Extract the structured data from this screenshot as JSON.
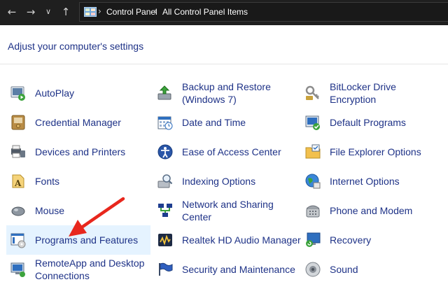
{
  "address_bar": {
    "crumbs": [
      "Control Panel",
      "All Control Panel Items"
    ]
  },
  "heading": "Adjust your computer's settings",
  "items": [
    {
      "label": "AutoPlay",
      "icon": "autoplay-icon"
    },
    {
      "label": "Backup and Restore (Windows 7)",
      "icon": "backup-restore-icon"
    },
    {
      "label": "BitLocker Drive Encryption",
      "icon": "bitlocker-icon"
    },
    {
      "label": "Credential Manager",
      "icon": "credential-manager-icon"
    },
    {
      "label": "Date and Time",
      "icon": "date-time-icon"
    },
    {
      "label": "Default Programs",
      "icon": "default-programs-icon"
    },
    {
      "label": "Devices and Printers",
      "icon": "devices-printers-icon"
    },
    {
      "label": "Ease of Access Center",
      "icon": "ease-of-access-icon"
    },
    {
      "label": "File Explorer Options",
      "icon": "file-explorer-options-icon"
    },
    {
      "label": "Fonts",
      "icon": "fonts-icon"
    },
    {
      "label": "Indexing Options",
      "icon": "indexing-options-icon"
    },
    {
      "label": "Internet Options",
      "icon": "internet-options-icon"
    },
    {
      "label": "Mouse",
      "icon": "mouse-icon"
    },
    {
      "label": "Network and Sharing Center",
      "icon": "network-sharing-icon"
    },
    {
      "label": "Phone and Modem",
      "icon": "phone-modem-icon"
    },
    {
      "label": "Programs and Features",
      "icon": "programs-features-icon",
      "selected": true
    },
    {
      "label": "Realtek HD Audio Manager",
      "icon": "realtek-audio-icon"
    },
    {
      "label": "Recovery",
      "icon": "recovery-icon"
    },
    {
      "label": "RemoteApp and Desktop Connections",
      "icon": "remoteapp-icon"
    },
    {
      "label": "Security and Maintenance",
      "icon": "security-maintenance-icon"
    },
    {
      "label": "Sound",
      "icon": "sound-icon"
    }
  ],
  "colors": {
    "link_text": "#1e3287",
    "selected_bg": "#e5f3ff",
    "titlebar_bg": "#1f1f1f",
    "annotation_arrow": "#e8271d"
  }
}
